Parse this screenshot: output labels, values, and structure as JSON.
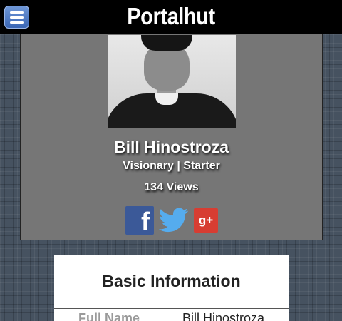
{
  "header": {
    "brand": "Portalhut",
    "menu_icon": "hamburger-menu-icon",
    "menu_color": "#4a78c4"
  },
  "profile": {
    "name": "Bill Hinostroza",
    "role": "Visionary | Starter",
    "views": "134 Views",
    "social": [
      {
        "name": "facebook",
        "icon": "facebook-icon",
        "glyph": "f",
        "color": "#3b5998"
      },
      {
        "name": "twitter",
        "icon": "twitter-bird-icon",
        "color": "#55acee"
      },
      {
        "name": "google-plus",
        "icon": "google-plus-icon",
        "glyph": "g+",
        "color": "#d73d32"
      }
    ]
  },
  "basic_info": {
    "title": "Basic Information",
    "rows": [
      {
        "label": "Full Name",
        "value": "Bill Hinostroza"
      }
    ]
  }
}
